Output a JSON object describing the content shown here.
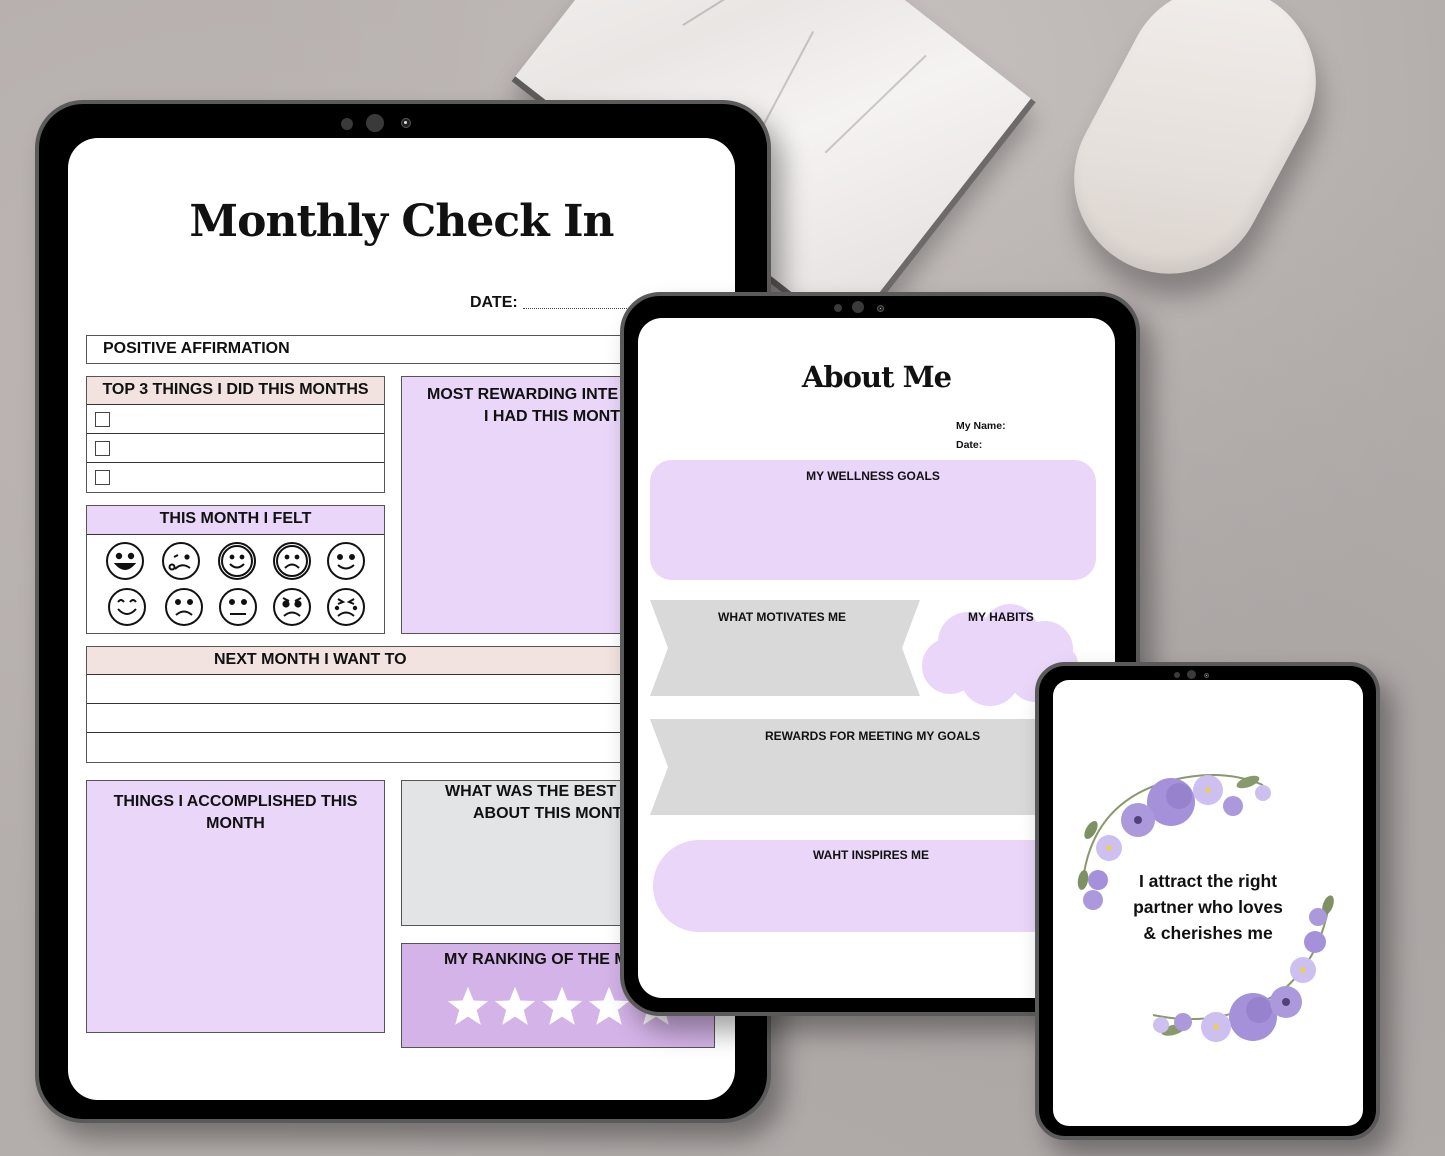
{
  "monthly_check_in": {
    "title": "Monthly Check In",
    "date_label": "DATE:",
    "positive_affirmation": "POSITIVE AFFIRMATION",
    "top3_header": "TOP 3 THINGS I DID THIS MONTHS",
    "top3_items": [
      "",
      "",
      ""
    ],
    "felt_header": "THIS MONTH I FELT",
    "moods": [
      "big-grin",
      "crying",
      "smile-outline",
      "frown-outline",
      "smile",
      "happy-eyes-closed",
      "sad",
      "neutral",
      "angry",
      "upset"
    ],
    "rewarding_interaction": "MOST REWARDING INTE\nI HAD THIS MONT",
    "rewarding_line1": "MOST REWARDING INTE",
    "rewarding_line2": "I HAD THIS MONT",
    "next_month_header": "NEXT MONTH I WANT TO",
    "next_month_items": [
      "",
      "",
      ""
    ],
    "accomplished_line1": "THINGS I ACCOMPLISHED THIS",
    "accomplished_line2": "MONTH",
    "best_line1": "WHAT WAS THE BEST",
    "best_line2": "ABOUT THIS MONT",
    "ranking_label": "MY RANKING OF THE M",
    "ranking_stars_total": 5
  },
  "about_me": {
    "title": "About Me",
    "name_label": "My Name:",
    "date_label": "Date:",
    "wellness_goals": "MY WELLNESS GOALS",
    "motivates": "WHAT MOTIVATES ME",
    "habits": "MY HABITS",
    "rewards": "REWARDS FOR MEETING  MY GOALS",
    "inspires": "WAHT INSPIRES ME"
  },
  "affirmation_card": {
    "line1": "I attract the right",
    "line2": "partner who loves",
    "line3": "& cherishes me"
  },
  "colors": {
    "lavender": "#e9d6f8",
    "deep_lavender": "#d4b3e8",
    "blush": "#f2e2e0",
    "grey": "#e3e4e6",
    "ribbon_grey": "#d9d9d9"
  }
}
